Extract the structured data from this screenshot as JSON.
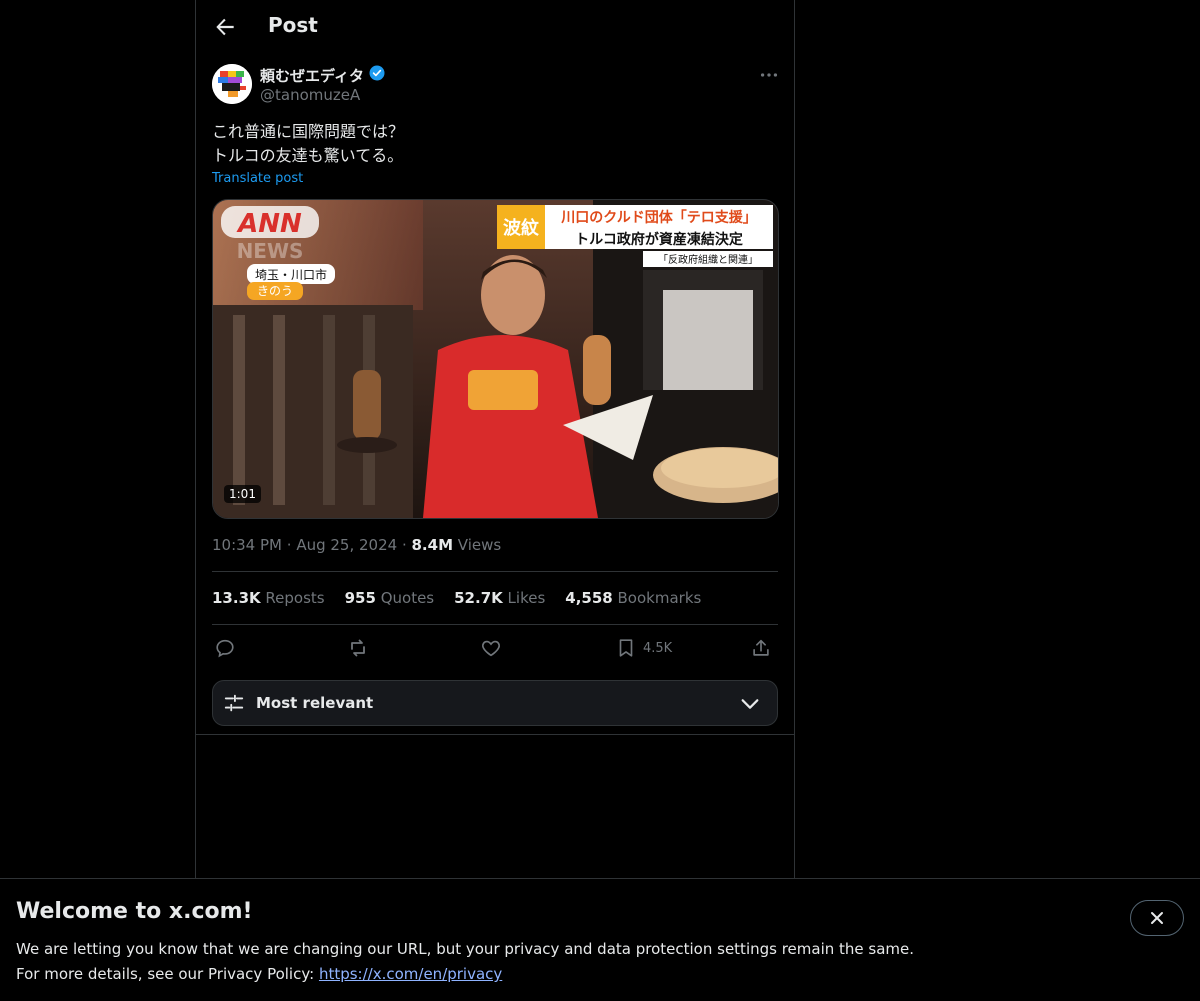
{
  "header": {
    "title": "Post"
  },
  "post": {
    "author_name": "頼むぜエディタ",
    "handle": "@tanomuzeA",
    "text_line1": "これ普通に国際問題では？",
    "text_line2": "トルコの友達も驚いてる。",
    "translate_label": "Translate post",
    "media": {
      "duration": "1:01",
      "logo_line1": "ANN",
      "logo_line2": "NEWS",
      "location": "埼玉・川口市",
      "day": "きのう",
      "headline_tag": "波紋",
      "headline_line1": "川口のクルド団体「テロ支援」",
      "headline_line2": "トルコ政府が資産凍結決定",
      "subcaption": "「反政府組織と関連」"
    },
    "time": "10:34 PM",
    "date": "Aug 25, 2024",
    "views_count": "8.4M",
    "views_label": "Views"
  },
  "stats": {
    "reposts_count": "13.3K",
    "reposts_label": "Reposts",
    "quotes_count": "955",
    "quotes_label": "Quotes",
    "likes_count": "52.7K",
    "likes_label": "Likes",
    "bookmarks_count": "4,558",
    "bookmarks_label": "Bookmarks"
  },
  "actions": {
    "bookmark_count": "4.5K"
  },
  "sort": {
    "label": "Most relevant"
  },
  "banner": {
    "title": "Welcome to x.com!",
    "line1": "We are letting you know that we are changing our URL, but your privacy and data protection settings remain the same.",
    "line2_prefix": "For more details, see our Privacy Policy: ",
    "link": "https://x.com/en/privacy"
  },
  "colors": {
    "accent": "#1d9bf0",
    "muted": "#71767b",
    "border": "#2f3336"
  }
}
